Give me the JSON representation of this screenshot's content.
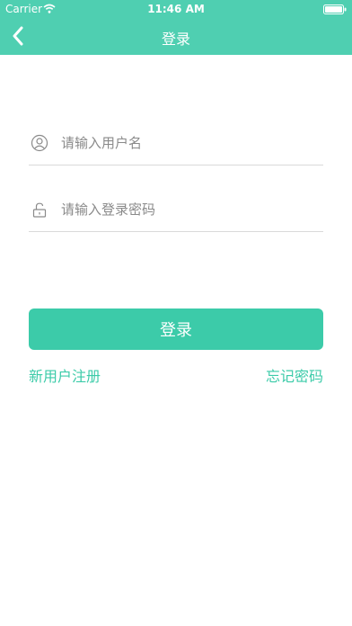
{
  "status_bar": {
    "carrier": "Carrier",
    "time": "11:46 AM"
  },
  "nav": {
    "title": "登录",
    "back_icon": "chevron-left-icon"
  },
  "form": {
    "username": {
      "placeholder": "请输入用户名",
      "value": "",
      "icon": "user-icon"
    },
    "password": {
      "placeholder": "请输入登录密码",
      "value": "",
      "icon": "lock-icon"
    },
    "login_label": "登录"
  },
  "links": {
    "register": "新用户注册",
    "forgot_password": "忘记密码"
  },
  "colors": {
    "header": "#4fcfb1",
    "accent": "#3ccba9",
    "divider": "#d9d9d9",
    "placeholder": "#8a8a8a"
  }
}
